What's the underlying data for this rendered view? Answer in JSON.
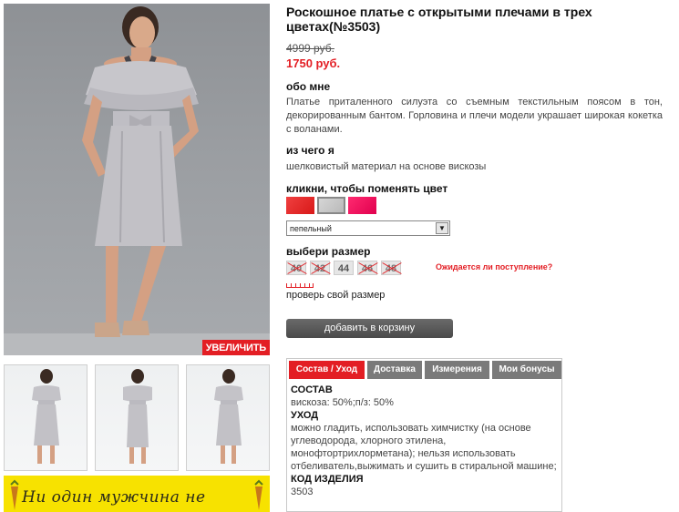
{
  "product": {
    "title": "Роскошное платье с открытыми плечами в трех цветах(№3503)",
    "old_price": "4999 руб.",
    "new_price": "1750 руб."
  },
  "gallery": {
    "zoom_label": "УВЕЛИЧИТЬ",
    "thumbnail_count": 3
  },
  "banner": {
    "text": "Ни один мужчина не"
  },
  "about": {
    "heading": "обо мне",
    "text": "Платье приталенного силуэта со съемным текстильным поясом в тон, декорированным бантом. Горловина и плечи модели украшает широкая кокетка с воланами."
  },
  "material": {
    "heading": "из чего я",
    "text": "шелковистый материал на основе вискозы"
  },
  "color": {
    "heading": "кликни, чтобы поменять цвет",
    "selected": "пепельный",
    "swatches": [
      "#e52a2a",
      "#c8c8c8",
      "#f0115c"
    ]
  },
  "size": {
    "heading": "выбери размер",
    "options": [
      {
        "label": "40",
        "available": false
      },
      {
        "label": "42",
        "available": false
      },
      {
        "label": "44",
        "available": true
      },
      {
        "label": "46",
        "available": false
      },
      {
        "label": "48",
        "available": false
      }
    ],
    "notify_link": "Ожидается ли поступление?",
    "check_size": "проверь свой размер"
  },
  "cart": {
    "add_label": "добавить в корзину"
  },
  "tabs": [
    {
      "label": "Состав / Уход",
      "active": true
    },
    {
      "label": "Доставка",
      "active": false
    },
    {
      "label": "Измерения",
      "active": false
    },
    {
      "label": "Мои бонусы",
      "active": false
    }
  ],
  "tab_content": {
    "composition_heading": "СОСТАВ",
    "composition_text": "вискоза: 50%;п/з: 50%",
    "care_heading": "УХОД",
    "care_text": "можно гладить, использовать химчистку (на основе углеводорода, хлорного этилена, монофтортрихлорметана); нельзя использовать отбеливатель,выжимать и сушить в стиральной машине;",
    "code_heading": "КОД ИЗДЕЛИЯ",
    "code_value": "3503"
  },
  "colors": {
    "accent": "#e31e24",
    "button": "#555555",
    "banner": "#f7e200"
  }
}
